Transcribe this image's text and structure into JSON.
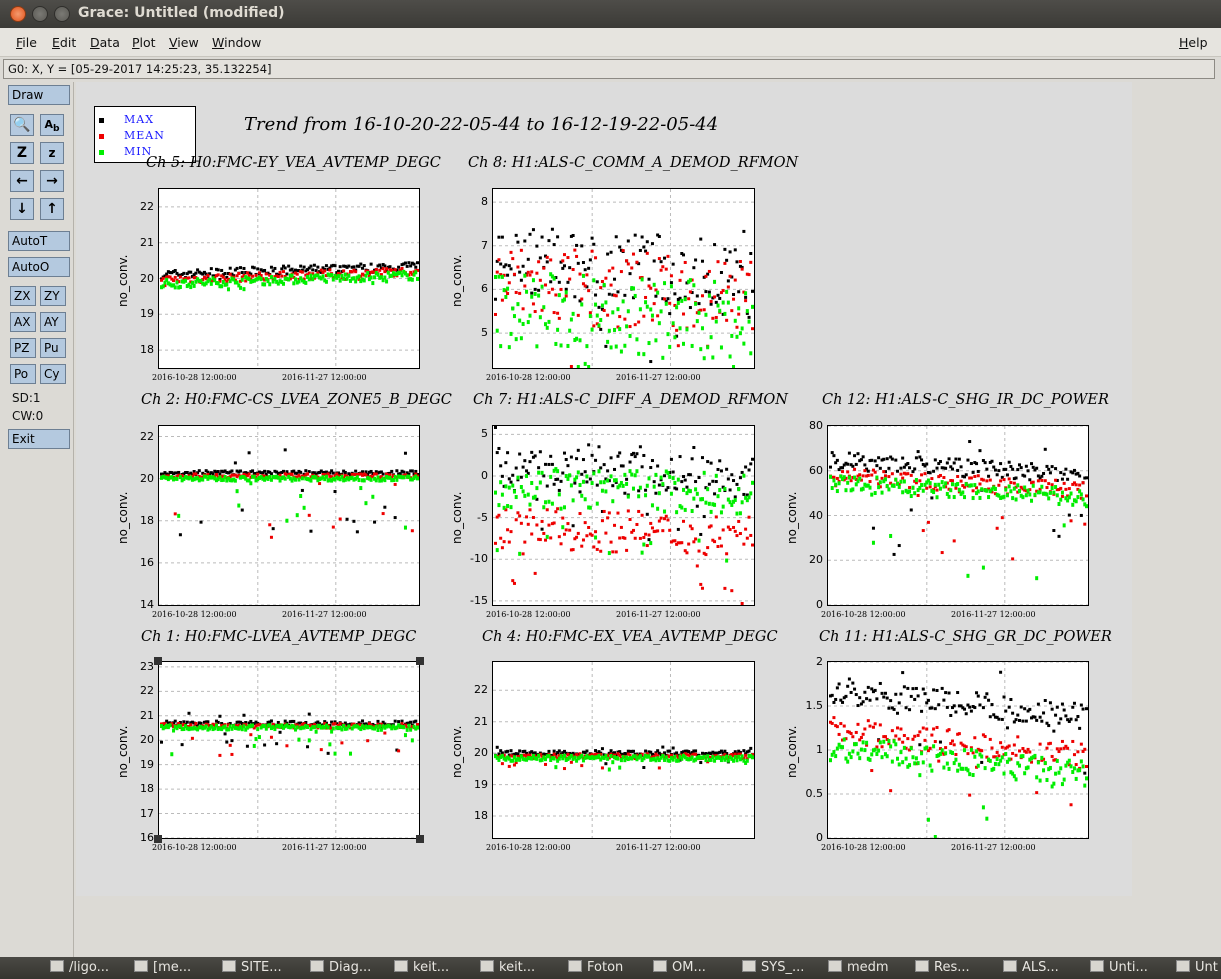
{
  "window": {
    "title": "Grace: Untitled (modified)"
  },
  "menu": [
    "File",
    "Edit",
    "Data",
    "Plot",
    "View",
    "Window",
    "Help"
  ],
  "status": {
    "coordinates": "G0: X, Y = [05-29-2017 14:25:23, 35.132254]"
  },
  "toolbar": {
    "draw": "Draw",
    "autot": "AutoT",
    "autoo": "AutoO",
    "zx": "ZX",
    "zy": "ZY",
    "ax": "AX",
    "ay": "AY",
    "pz": "PZ",
    "pu": "Pu",
    "po": "Po",
    "cy": "Cy",
    "sd": "SD:1",
    "cw": "CW:0",
    "exit": "Exit"
  },
  "plot": {
    "main_title": "Trend from 16-10-20-22-05-44 to 16-12-19-22-05-44",
    "legend": [
      "MAX",
      "MEAN",
      "MIN"
    ],
    "colors": {
      "max": "#000000",
      "mean": "#ee0000",
      "min": "#00ee00",
      "legend_text": "#1a1aff"
    },
    "ylabel": "no_conv.",
    "xticks": [
      "2016-10-28 12:00:00",
      "2016-11-27 12:00:00"
    ]
  },
  "chart_data": [
    {
      "type": "scatter",
      "title": "Ch 5: H0:FMC-EY_VEA_AVTEMP_DEGC",
      "ylabel": "no_conv.",
      "yticks": [
        "18",
        "19",
        "20",
        "21",
        "22"
      ],
      "ylim": [
        17.5,
        22.5
      ],
      "grid": true,
      "series": [
        {
          "name": "MAX",
          "baseline": 20.15
        },
        {
          "name": "MEAN",
          "baseline": 20.0
        },
        {
          "name": "MIN",
          "baseline": 19.9
        }
      ]
    },
    {
      "type": "scatter",
      "title": "Ch 8: H1:ALS-C_COMM_A_DEMOD_RFMON",
      "ylabel": "no_conv.",
      "yticks": [
        "5",
        "6",
        "7",
        "8"
      ],
      "ylim": [
        4.2,
        8.3
      ],
      "grid": true,
      "series": [
        {
          "name": "MAX",
          "baseline": 6.6
        },
        {
          "name": "MEAN",
          "baseline": 6.2
        },
        {
          "name": "MIN",
          "baseline": 5.6
        }
      ]
    },
    {
      "type": "scatter",
      "title": "Ch 2: H0:FMC-CS_LVEA_ZONE5_B_DEGC",
      "ylabel": "no_conv.",
      "yticks": [
        "14",
        "16",
        "18",
        "20",
        "22"
      ],
      "ylim": [
        14,
        22.5
      ],
      "grid": true,
      "series": [
        {
          "name": "MAX",
          "baseline": 20.35
        },
        {
          "name": "MEAN",
          "baseline": 20.2
        },
        {
          "name": "MIN",
          "baseline": 20.1
        }
      ]
    },
    {
      "type": "scatter",
      "title": "Ch 7: H1:ALS-C_DIFF_A_DEMOD_RFMON",
      "ylabel": "no_conv.",
      "yticks": [
        "-15",
        "-10",
        "-5",
        "0",
        "5"
      ],
      "ylim": [
        -15.5,
        6
      ],
      "grid": true,
      "series": [
        {
          "name": "MAX",
          "baseline": 1.0
        },
        {
          "name": "MEAN",
          "baseline": -6.0
        },
        {
          "name": "MIN",
          "baseline": -1.0
        }
      ]
    },
    {
      "type": "scatter",
      "title": "Ch 12: H1:ALS-C_SHG_IR_DC_POWER",
      "ylabel": "no_conv.",
      "yticks": [
        "0",
        "20",
        "40",
        "60",
        "80"
      ],
      "ylim": [
        0,
        80
      ],
      "grid": true,
      "series": [
        {
          "name": "MAX",
          "baseline": 65
        },
        {
          "name": "MEAN",
          "baseline": 58
        },
        {
          "name": "MIN",
          "baseline": 55
        }
      ]
    },
    {
      "type": "scatter",
      "title": "Ch 1: H0:FMC-LVEA_AVTEMP_DEGC",
      "ylabel": "no_conv.",
      "yticks": [
        "16",
        "17",
        "18",
        "19",
        "20",
        "21",
        "22",
        "23"
      ],
      "ylim": [
        16,
        23.2
      ],
      "grid": true,
      "series": [
        {
          "name": "MAX",
          "baseline": 20.75
        },
        {
          "name": "MEAN",
          "baseline": 20.65
        },
        {
          "name": "MIN",
          "baseline": 20.6
        }
      ]
    },
    {
      "type": "scatter",
      "title": "Ch 4: H0:FMC-EX_VEA_AVTEMP_DEGC",
      "ylabel": "no_conv.",
      "yticks": [
        "18",
        "19",
        "20",
        "21",
        "22"
      ],
      "ylim": [
        17.3,
        22.9
      ],
      "grid": true,
      "series": [
        {
          "name": "MAX",
          "baseline": 20.05
        },
        {
          "name": "MEAN",
          "baseline": 19.95
        },
        {
          "name": "MIN",
          "baseline": 19.9
        }
      ]
    },
    {
      "type": "scatter",
      "title": "Ch 11: H1:ALS-C_SHG_GR_DC_POWER",
      "ylabel": "no_conv.",
      "yticks": [
        "0",
        "0.5",
        "1",
        "1.5",
        "2"
      ],
      "ylim": [
        0,
        2
      ],
      "grid": true,
      "series": [
        {
          "name": "MAX",
          "baseline": 1.7
        },
        {
          "name": "MEAN",
          "baseline": 1.25
        },
        {
          "name": "MIN",
          "baseline": 1.05
        }
      ]
    }
  ],
  "taskbar": [
    "/ligo...",
    "[me...",
    "SITE...",
    "Diag...",
    "keit...",
    "keit...",
    "Foton",
    "OM...",
    "SYS_...",
    "medm",
    "Res...",
    "ALS...",
    "Unti...",
    "Unt"
  ]
}
